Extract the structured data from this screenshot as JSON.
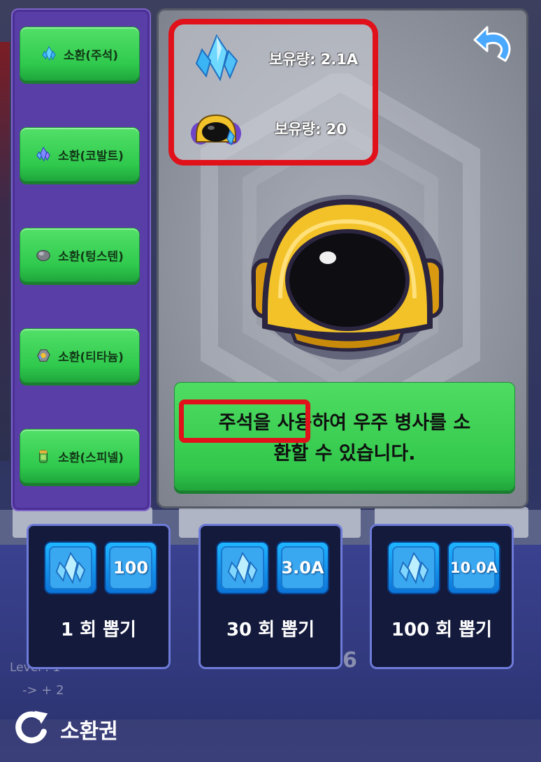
{
  "side_menu": {
    "items": [
      {
        "label": "소환(주석)",
        "icon": "crystal-icon"
      },
      {
        "label": "소환(코발트)",
        "icon": "cobalt-crystal-icon"
      },
      {
        "label": "소환(텅스텐)",
        "icon": "tungsten-ore-icon"
      },
      {
        "label": "소환(티타늄)",
        "icon": "titanium-ore-icon"
      },
      {
        "label": "소환(스피넬)",
        "icon": "spinel-canister-icon"
      }
    ]
  },
  "holdings": {
    "crystal": {
      "label": "보유량: 2.1A",
      "icon": "crystal-icon"
    },
    "helmet_ticket": {
      "label": "보유량: 20",
      "icon": "helmet-ticket-icon"
    }
  },
  "description": {
    "text": "주석을 사용하여 우주 병사를 소환할 수 있습니다.",
    "line1": "주석을 사용하여 우주 병사를 소",
    "line2": "환할 수 있습니다.",
    "highlighted": "주석을 사용"
  },
  "draw_options": [
    {
      "cost": "100",
      "label": "1 회 뽑기"
    },
    {
      "cost": "3.0A",
      "label": "30 회 뽑기"
    },
    {
      "cost": "10.0A",
      "label": "100 회 뽑기"
    }
  ],
  "footer": {
    "label": "소환권"
  },
  "background": {
    "level": "Level : 1",
    "level_sub": "-> + 2",
    "number": "6"
  },
  "colors": {
    "highlight": "#e0111a",
    "button_green": "#32c84c",
    "panel_purple": "#5a3ea8"
  }
}
